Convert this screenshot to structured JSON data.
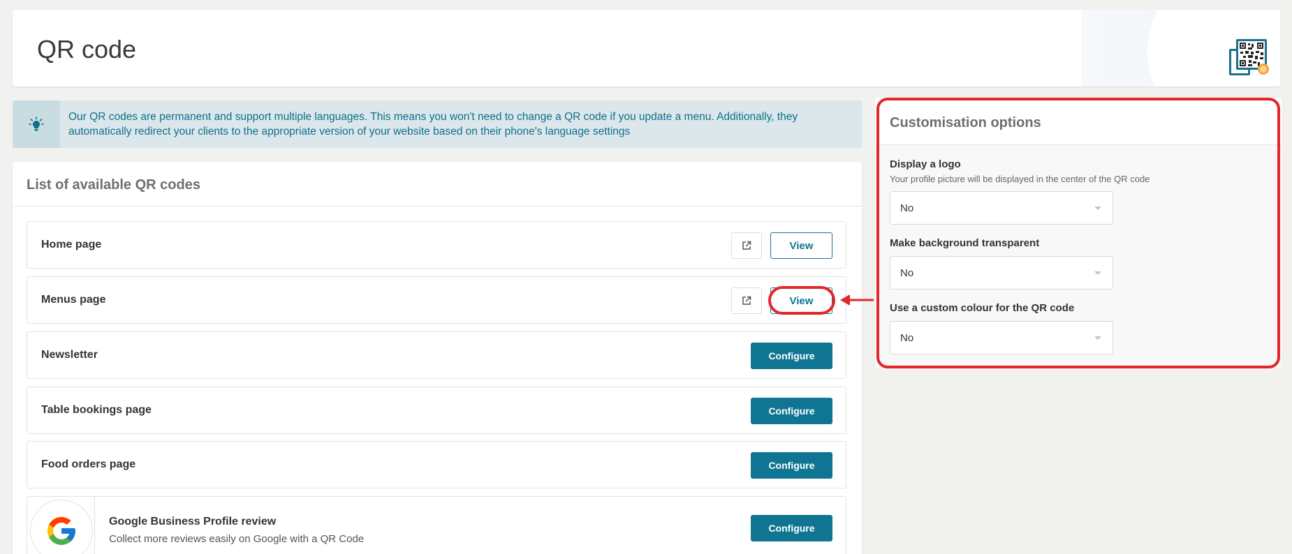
{
  "header": {
    "title": "QR code"
  },
  "info_banner": {
    "text": "Our QR codes are permanent and support multiple languages. This means you won't need to change a QR code if you update a menu. Additionally, they automatically redirect your clients to the appropriate version of your website based on their phone's language settings",
    "icon": "lightbulb-icon"
  },
  "qr_list": {
    "title": "List of available QR codes",
    "rows": [
      {
        "label": "Home page",
        "action": "View"
      },
      {
        "label": "Menus page",
        "action": "View"
      },
      {
        "label": "Newsletter",
        "action": "Configure"
      },
      {
        "label": "Table bookings page",
        "action": "Configure"
      },
      {
        "label": "Food orders page",
        "action": "Configure"
      }
    ],
    "google": {
      "title": "Google Business Profile review",
      "subtitle": "Collect more reviews easily on Google with a QR Code",
      "action": "Configure"
    }
  },
  "customisation": {
    "title": "Customisation options",
    "options": [
      {
        "label": "Display a logo",
        "description": "Your profile picture will be displayed in the center of the QR code",
        "value": "No"
      },
      {
        "label": "Make background transparent",
        "value": "No"
      },
      {
        "label": "Use a custom colour for the QR code",
        "value": "No"
      }
    ]
  },
  "colors": {
    "accent": "#0f7592",
    "annotation": "#e3262b",
    "banner_bg": "#dbe7ea",
    "banner_text": "#0f6f8c"
  }
}
